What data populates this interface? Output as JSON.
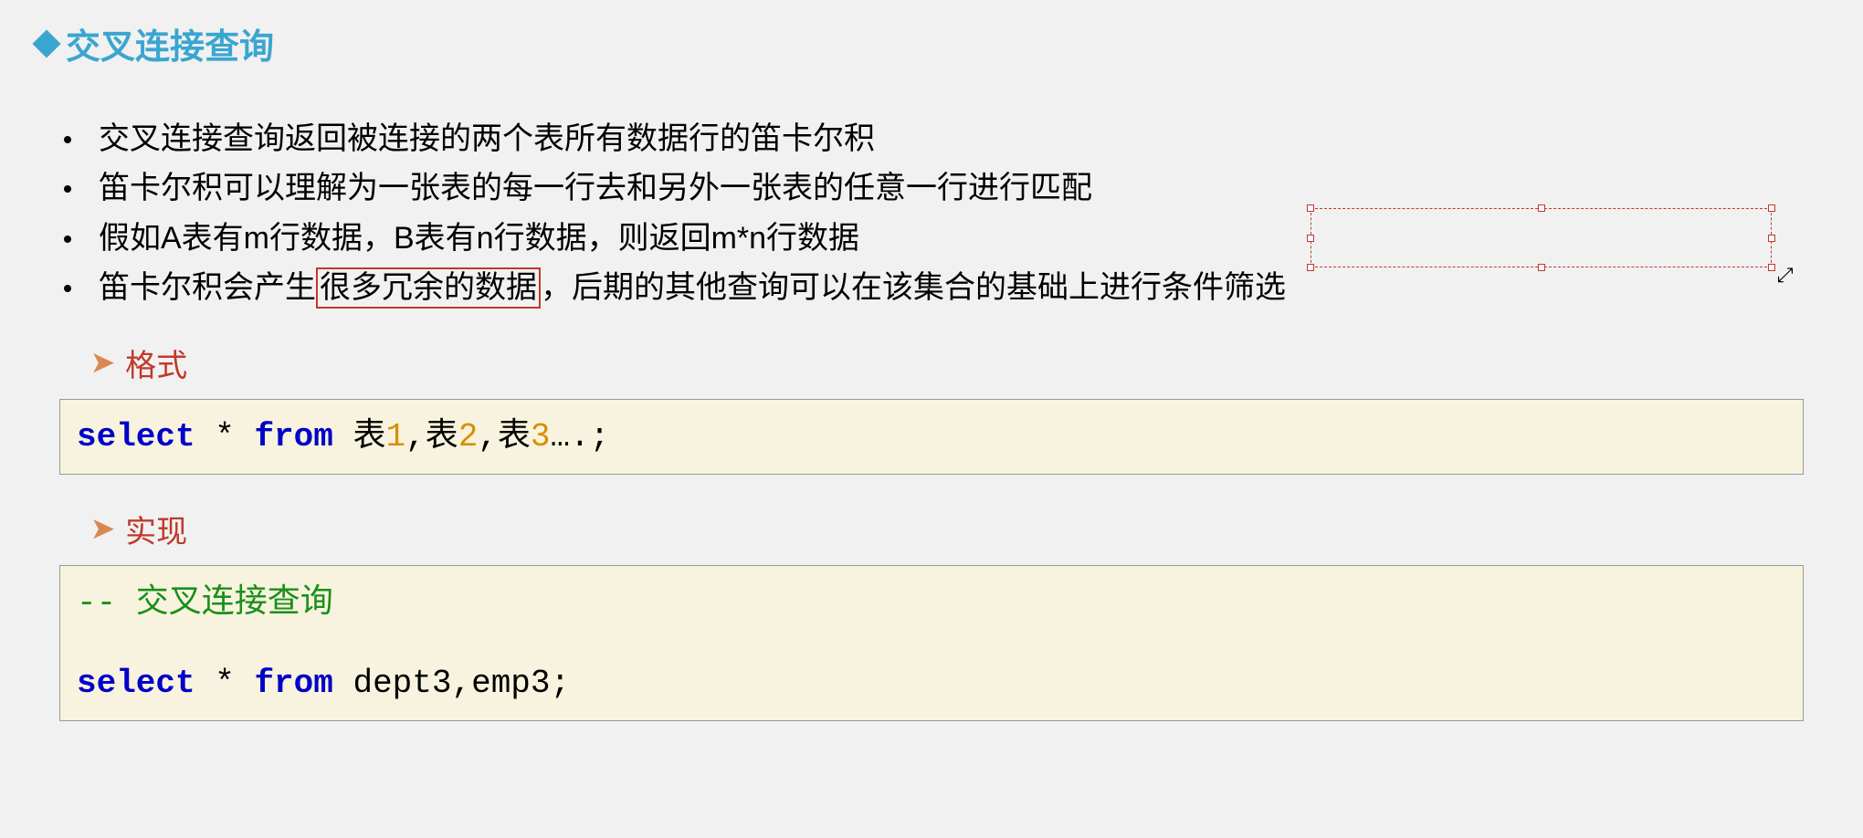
{
  "title": "交叉连接查询",
  "bullets": [
    "交叉连接查询返回被连接的两个表所有数据行的笛卡尔积",
    "笛卡尔积可以理解为一张表的每一行去和另外一张表的任意一行进行匹配",
    "假如A表有m行数据，B表有n行数据，则返回m*n行数据"
  ],
  "bullet4_pre": "笛卡尔积会产生",
  "bullet4_boxed": "很多冗余的数据",
  "bullet4_post": "，后期的其他查询可以在该集合的基础上进行条件筛选",
  "sub1": "格式",
  "code1": {
    "kw1": "select",
    "star": " * ",
    "kw2": "from",
    "t1": " 表",
    "n1": "1",
    "c1": ",表",
    "n2": "2",
    "c2": ",表",
    "n3": "3",
    "tail": "….;"
  },
  "sub2": "实现",
  "code2": {
    "comment": "-- 交叉连接查询",
    "kw1": "select",
    "star": " * ",
    "kw2": "from",
    "rest": " dept3,emp3;"
  }
}
